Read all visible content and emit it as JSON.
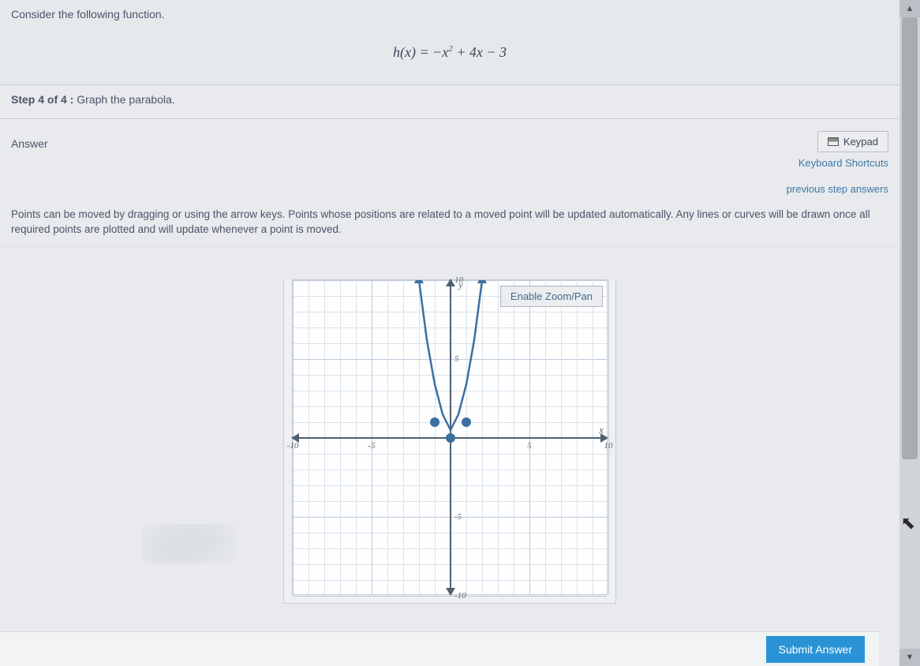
{
  "question": {
    "prompt": "Consider the following function.",
    "equation_html": "h(x) = −x<sup>2</sup> + 4x − 3",
    "step_label": "Step 4 of 4 :",
    "step_text": "Graph the parabola."
  },
  "answer": {
    "label": "Answer",
    "keypad_label": "Keypad",
    "shortcut_label": "Keyboard Shortcuts",
    "prev_answers_label": "previous step answers",
    "instructions": "Points can be moved by dragging or using the arrow keys. Points whose positions are related to a moved point will be updated automatically. Any lines or curves will be drawn once all required points are plotted and will update whenever a point is moved.",
    "zoom_label": "Enable Zoom/Pan"
  },
  "chart_data": {
    "type": "line",
    "xlabel": "x",
    "ylabel": "y",
    "xlim": [
      -10,
      10
    ],
    "ylim": [
      -10,
      10
    ],
    "x_ticks": [
      -10,
      -5,
      5,
      10
    ],
    "y_ticks": [
      -10,
      -5,
      5,
      10
    ],
    "grid": true,
    "series": [
      {
        "name": "parabola",
        "x": [
          -2,
          -1.5,
          -1,
          -0.5,
          0,
          0.5,
          1,
          1.5,
          2
        ],
        "y": [
          10,
          6.2,
          3.4,
          1.5,
          0.5,
          1.5,
          3.4,
          6.2,
          10
        ]
      }
    ],
    "points": [
      {
        "x": -1,
        "y": 1
      },
      {
        "x": 0,
        "y": 0
      },
      {
        "x": 1,
        "y": 1
      }
    ]
  },
  "submit_label": "Submit Answer"
}
